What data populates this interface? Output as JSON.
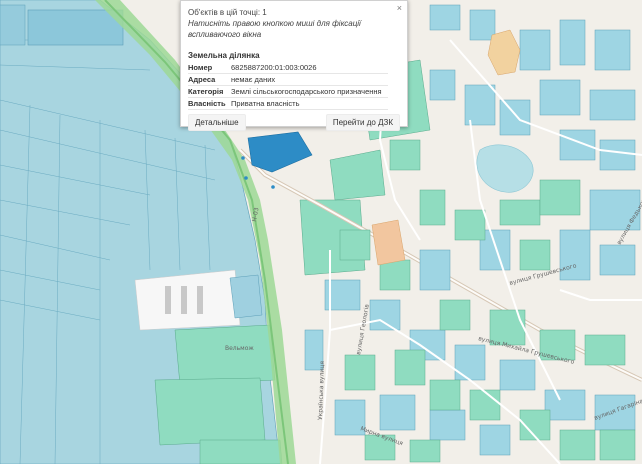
{
  "popup": {
    "close_glyph": "×",
    "objects_count": "Об'єктів в цій точці: 1",
    "hint": "Натисніть правою кнопкою миші для фіксації вспливаючого вікна",
    "section_title": "Земельна ділянка",
    "rows": [
      {
        "key": "Номер",
        "value": "6825887200:01:003:0026"
      },
      {
        "key": "Адреса",
        "value": "немає даних"
      },
      {
        "key": "Категорія",
        "value": "Землі сільськогосподарського призначення"
      },
      {
        "key": "Власність",
        "value": "Приватна власність"
      }
    ],
    "details_button": "Детальніше",
    "goto_button": "Перейти до ДЗК"
  },
  "map": {
    "road_label_h03": "Н-03",
    "street_labels": [
      "вулиця Михайла Грушевського",
      "вулиця Грушевського",
      "вулиця Геологів",
      "Українська вулиця",
      "Мирна вулиця",
      "вулиця Гагаріна",
      "вулиця Федьковича"
    ],
    "place_label": "Вельмож",
    "colors": {
      "cadastre_blue": "#9ed5e3",
      "cadastre_green": "#8fdcc0",
      "highlight_blue": "#2d8cc6",
      "highway": "#9ed895",
      "background": "#f2efe9"
    }
  }
}
